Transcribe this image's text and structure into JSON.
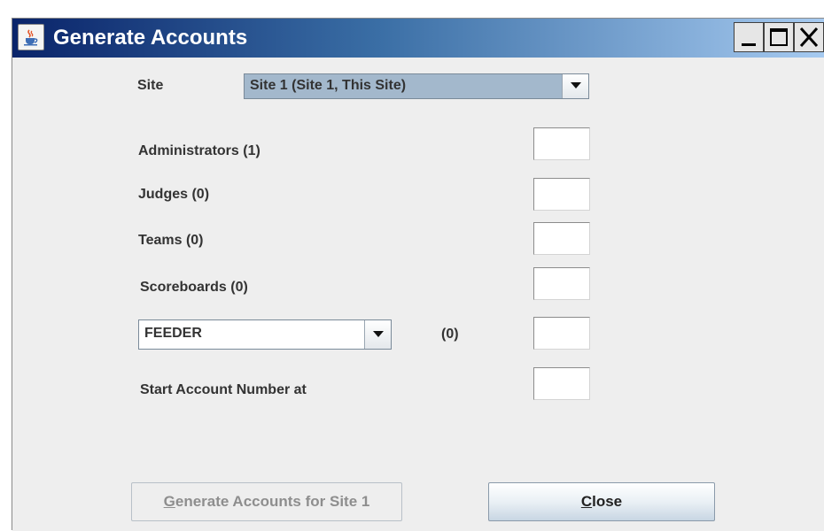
{
  "window": {
    "title": "Generate Accounts"
  },
  "form": {
    "site_label": "Site",
    "site_value": "Site 1 (Site 1, This Site)",
    "rows": [
      {
        "label": "Administrators (1)",
        "value": ""
      },
      {
        "label": "Judges (0)",
        "value": ""
      },
      {
        "label": "Teams (0)",
        "value": ""
      },
      {
        "label": "Scoreboards (0)",
        "value": ""
      }
    ],
    "type_value": "FEEDER",
    "type_count": "(0)",
    "type_field_value": "",
    "start_label": "Start Account Number at",
    "start_value": ""
  },
  "buttons": {
    "generate_mnemonic": "G",
    "generate_rest": "enerate Accounts for Site 1",
    "close_mnemonic": "C",
    "close_rest": "lose"
  },
  "colors": {
    "title_gradient_start": "#0a246a",
    "title_gradient_end": "#a6caf0",
    "site_combo_bg": "#a3b8cc",
    "dialog_bg": "#eeeeee"
  },
  "icons": {
    "app": "java-coffee-cup-icon",
    "minimize": "minimize-icon",
    "maximize": "maximize-icon",
    "close": "close-icon",
    "dropdown": "chevron-down-icon"
  }
}
